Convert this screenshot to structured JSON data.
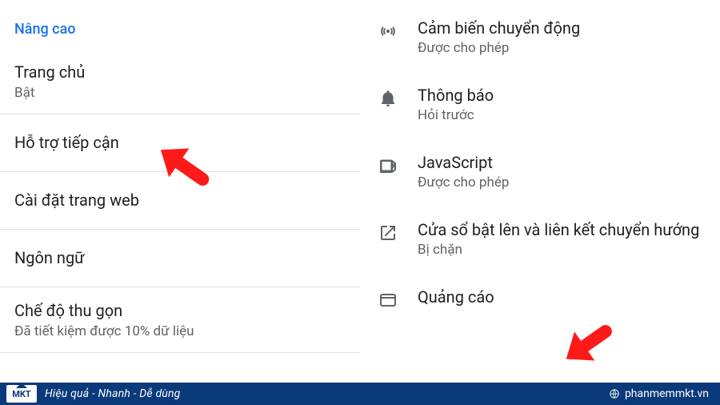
{
  "left": {
    "heading": "Nâng cao",
    "items": [
      {
        "title": "Trang chủ",
        "sub": "Bật"
      },
      {
        "title": "Hỗ trợ tiếp cận",
        "sub": ""
      },
      {
        "title": "Cài đặt trang web",
        "sub": ""
      },
      {
        "title": "Ngôn ngữ",
        "sub": ""
      },
      {
        "title": "Chế độ thu gọn",
        "sub": "Đã tiết kiệm được 10% dữ liệu"
      }
    ]
  },
  "right": {
    "items": [
      {
        "icon": "motion-sensor-icon",
        "title": "Cảm biến chuyển động",
        "sub": "Được cho phép"
      },
      {
        "icon": "bell-icon",
        "title": "Thông báo",
        "sub": "Hỏi trước"
      },
      {
        "icon": "javascript-icon",
        "title": "JavaScript",
        "sub": "Được cho phép"
      },
      {
        "icon": "popup-redirect-icon",
        "title": "Cửa sổ bật lên và liên kết chuyển hướng",
        "sub": "Bị chặn"
      },
      {
        "icon": "ads-icon",
        "title": "Quảng cáo",
        "sub": ""
      }
    ]
  },
  "footer": {
    "logo_text": "MKT",
    "slogan": "Hiệu quả - Nhanh - Dễ dùng",
    "site": "phanmemmkt.vn"
  },
  "annotations": {
    "arrow_color": "#ff1a1a"
  }
}
